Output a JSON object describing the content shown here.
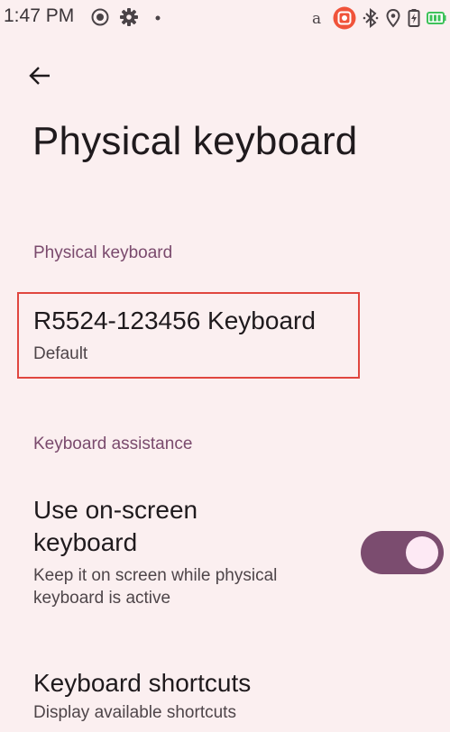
{
  "status_bar": {
    "time": "1:47 PM",
    "left_icons": [
      "screen-record-icon",
      "gear-icon",
      "dot-icon"
    ],
    "right_icons": [
      "amazon-a-icon",
      "app-notification-icon",
      "bluetooth-icon",
      "location-icon",
      "battery-saver-icon",
      "battery-icon"
    ],
    "app_notification_color": "#f0533a",
    "battery_color": "#3ec25a"
  },
  "header": {
    "back_icon": "arrow-left-icon",
    "title": "Physical keyboard"
  },
  "sections": {
    "physical_keyboard": {
      "header": "Physical keyboard",
      "device": {
        "title": "R5524-123456 Keyboard",
        "summary": "Default"
      }
    },
    "keyboard_assistance": {
      "header": "Keyboard assistance",
      "on_screen": {
        "title": "Use on-screen keyboard",
        "summary": "Keep it on screen while physical keyboard is active",
        "enabled": true
      },
      "shortcuts": {
        "title": "Keyboard shortcuts",
        "summary": "Display available shortcuts"
      }
    }
  },
  "colors": {
    "background": "#fbeff0",
    "accent": "#7b4c6f",
    "section_header": "#7a4a6d",
    "highlight": "#e0463f"
  }
}
